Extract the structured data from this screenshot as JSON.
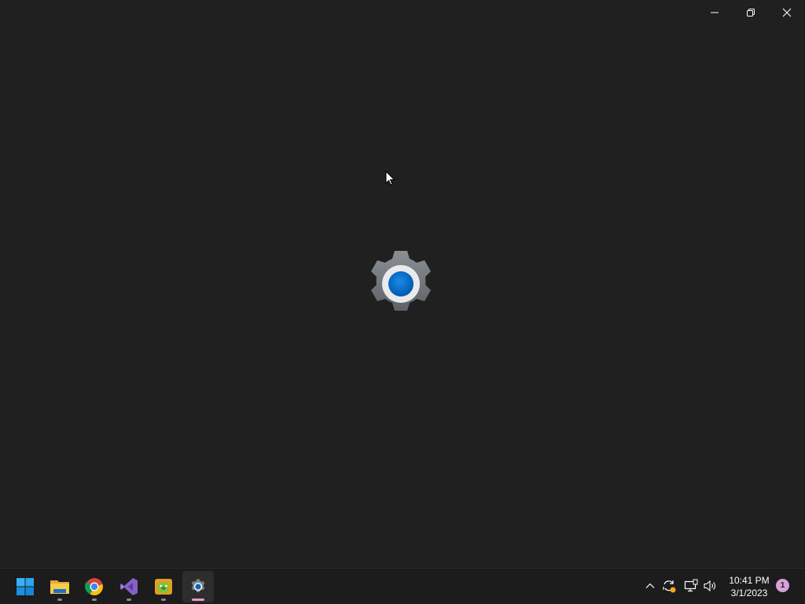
{
  "window": {
    "controls": {
      "minimize_icon": "minimize-icon",
      "restore_icon": "restore-icon",
      "close_icon": "close-icon"
    },
    "splash_icon": "settings-gear-icon"
  },
  "taskbar": {
    "apps": [
      {
        "icon": "start-windows-icon",
        "running": false,
        "active": false
      },
      {
        "icon": "file-explorer-icon",
        "running": true,
        "active": false
      },
      {
        "icon": "chrome-icon",
        "running": true,
        "active": false
      },
      {
        "icon": "visual-studio-icon",
        "running": true,
        "active": false
      },
      {
        "icon": "game-app-icon",
        "running": true,
        "active": false
      },
      {
        "icon": "settings-icon",
        "running": true,
        "active": true
      }
    ],
    "tray": {
      "icons": [
        "chevron-up-icon",
        "sync-update-icon",
        "network-icon",
        "volume-icon"
      ]
    },
    "clock": {
      "time": "10:41 PM",
      "date": "3/1/2023"
    },
    "notification_count": "1"
  },
  "colors": {
    "background": "#202020",
    "taskbar": "#1c1c1c",
    "accent": "#0067c0",
    "active_indicator": "#e59ac7"
  }
}
